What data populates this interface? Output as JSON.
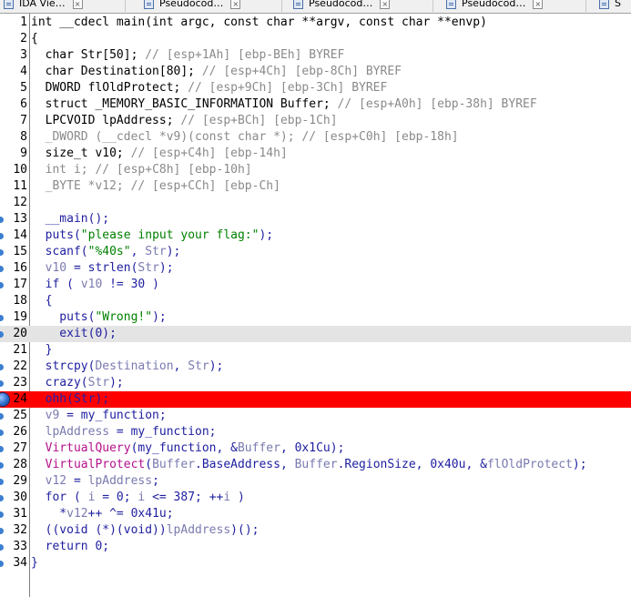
{
  "tabs": [
    {
      "label": "IDA Vie…"
    },
    {
      "label": "Pseudocod…"
    },
    {
      "label": "Pseudocod…"
    },
    {
      "label": "Pseudocod…"
    },
    {
      "label": "S"
    }
  ],
  "tab_close_glyph": "×",
  "colors": {
    "breakpoint_line": "#ff0000",
    "current_line": "#e4e4e4",
    "line_marker": "#3c7fd1"
  },
  "lines": [
    {
      "n": "1",
      "marker": "none",
      "hl": "",
      "t": [
        [
          "int __cdecl main(int argc, const char **argv, const char **envp)",
          "black"
        ]
      ]
    },
    {
      "n": "2",
      "marker": "none",
      "hl": "",
      "t": [
        [
          "{",
          "black"
        ]
      ]
    },
    {
      "n": "3",
      "marker": "none",
      "hl": "",
      "t": [
        [
          "  char Str[50]; ",
          "black"
        ],
        [
          "// [esp+1Ah] [ebp-BEh] BYREF",
          "gray"
        ]
      ]
    },
    {
      "n": "4",
      "marker": "none",
      "hl": "",
      "t": [
        [
          "  char Destination[80]; ",
          "black"
        ],
        [
          "// [esp+4Ch] [ebp-8Ch] BYREF",
          "gray"
        ]
      ]
    },
    {
      "n": "5",
      "marker": "none",
      "hl": "",
      "t": [
        [
          "  DWORD flOldProtect; ",
          "black"
        ],
        [
          "// [esp+9Ch] [ebp-3Ch] BYREF",
          "gray"
        ]
      ]
    },
    {
      "n": "6",
      "marker": "none",
      "hl": "",
      "t": [
        [
          "  struct _MEMORY_BASIC_INFORMATION Buffer; ",
          "black"
        ],
        [
          "// [esp+A0h] [ebp-38h] BYREF",
          "gray"
        ]
      ]
    },
    {
      "n": "7",
      "marker": "none",
      "hl": "",
      "t": [
        [
          "  LPCVOID lpAddress; ",
          "black"
        ],
        [
          "// [esp+BCh] [ebp-1Ch]",
          "gray"
        ]
      ]
    },
    {
      "n": "8",
      "marker": "none",
      "hl": "",
      "t": [
        [
          "  _DWORD (__cdecl *v9)(const char *); ",
          "gray"
        ],
        [
          "// [esp+C0h] [ebp-18h]",
          "gray"
        ]
      ]
    },
    {
      "n": "9",
      "marker": "none",
      "hl": "",
      "t": [
        [
          "  size_t v10; ",
          "black"
        ],
        [
          "// [esp+C4h] [ebp-14h]",
          "gray"
        ]
      ]
    },
    {
      "n": "10",
      "marker": "none",
      "hl": "",
      "t": [
        [
          "  int i; ",
          "gray"
        ],
        [
          "// [esp+C8h] [ebp-10h]",
          "gray"
        ]
      ]
    },
    {
      "n": "11",
      "marker": "none",
      "hl": "",
      "t": [
        [
          "  _BYTE *v12; ",
          "gray"
        ],
        [
          "// [esp+CCh] [ebp-Ch]",
          "gray"
        ]
      ]
    },
    {
      "n": "12",
      "marker": "none",
      "hl": "",
      "t": [
        [
          "",
          "black"
        ]
      ]
    },
    {
      "n": "13",
      "marker": "dot",
      "hl": "",
      "t": [
        [
          "  __main();",
          "blue"
        ]
      ]
    },
    {
      "n": "14",
      "marker": "dot",
      "hl": "",
      "t": [
        [
          "  puts(",
          "blue"
        ],
        [
          "\"please input your flag:\"",
          "green"
        ],
        [
          ");",
          "blue"
        ]
      ]
    },
    {
      "n": "15",
      "marker": "dot",
      "hl": "",
      "t": [
        [
          "  scanf(",
          "blue"
        ],
        [
          "\"%40s\"",
          "green"
        ],
        [
          ", ",
          "blue"
        ],
        [
          "Str",
          "mute"
        ],
        [
          ");",
          "blue"
        ]
      ]
    },
    {
      "n": "16",
      "marker": "dot",
      "hl": "",
      "t": [
        [
          "  v10",
          "mute"
        ],
        [
          " = strlen(",
          "blue"
        ],
        [
          "Str",
          "mute"
        ],
        [
          ");",
          "blue"
        ]
      ]
    },
    {
      "n": "17",
      "marker": "dot",
      "hl": "",
      "t": [
        [
          "  if ( ",
          "blue"
        ],
        [
          "v10",
          "mute"
        ],
        [
          " != 30 )",
          "blue"
        ]
      ]
    },
    {
      "n": "18",
      "marker": "none",
      "hl": "",
      "t": [
        [
          "  {",
          "blue"
        ]
      ]
    },
    {
      "n": "19",
      "marker": "dot",
      "hl": "",
      "t": [
        [
          "    puts(",
          "blue"
        ],
        [
          "\"Wrong!\"",
          "green"
        ],
        [
          ");",
          "blue"
        ]
      ]
    },
    {
      "n": "20",
      "marker": "dot",
      "hl": "gray",
      "t": [
        [
          "    exit(0);",
          "blue"
        ]
      ]
    },
    {
      "n": "21",
      "marker": "none",
      "hl": "",
      "t": [
        [
          "  }",
          "blue"
        ]
      ]
    },
    {
      "n": "22",
      "marker": "dot",
      "hl": "",
      "t": [
        [
          "  strcpy(",
          "blue"
        ],
        [
          "Destination",
          "mute"
        ],
        [
          ", ",
          "blue"
        ],
        [
          "Str",
          "mute"
        ],
        [
          ");",
          "blue"
        ]
      ]
    },
    {
      "n": "23",
      "marker": "dot",
      "hl": "",
      "t": [
        [
          "  crazy(",
          "blue"
        ],
        [
          "Str",
          "mute"
        ],
        [
          ");",
          "blue"
        ]
      ]
    },
    {
      "n": "24",
      "marker": "bp",
      "hl": "red",
      "t": [
        [
          "  ",
          "blue"
        ],
        [
          "ohh",
          "purple"
        ],
        [
          "(",
          "blue"
        ],
        [
          "Str",
          "mute"
        ],
        [
          ");",
          "blue"
        ]
      ]
    },
    {
      "n": "25",
      "marker": "dot",
      "hl": "",
      "t": [
        [
          "  v9",
          "mute"
        ],
        [
          " = my_function;",
          "blue"
        ]
      ]
    },
    {
      "n": "26",
      "marker": "dot",
      "hl": "",
      "t": [
        [
          "  lpAddress",
          "mute"
        ],
        [
          " = my_function;",
          "blue"
        ]
      ]
    },
    {
      "n": "27",
      "marker": "dot",
      "hl": "",
      "t": [
        [
          "  ",
          "blue"
        ],
        [
          "VirtualQuery",
          "mag"
        ],
        [
          "(my_function, &",
          "blue"
        ],
        [
          "Buffer",
          "mute"
        ],
        [
          ", 0x1Cu);",
          "blue"
        ]
      ]
    },
    {
      "n": "28",
      "marker": "dot",
      "hl": "",
      "t": [
        [
          "  ",
          "blue"
        ],
        [
          "VirtualProtect",
          "mag"
        ],
        [
          "(",
          "blue"
        ],
        [
          "Buffer",
          "mute"
        ],
        [
          ".BaseAddress, ",
          "blue"
        ],
        [
          "Buffer",
          "mute"
        ],
        [
          ".RegionSize, 0x40u, &",
          "blue"
        ],
        [
          "flOldProtect",
          "mute"
        ],
        [
          ");",
          "blue"
        ]
      ]
    },
    {
      "n": "29",
      "marker": "dot",
      "hl": "",
      "t": [
        [
          "  v12",
          "mute"
        ],
        [
          " = ",
          "blue"
        ],
        [
          "lpAddress",
          "mute"
        ],
        [
          ";",
          "blue"
        ]
      ]
    },
    {
      "n": "30",
      "marker": "dot",
      "hl": "",
      "t": [
        [
          "  for ( ",
          "blue"
        ],
        [
          "i",
          "mute"
        ],
        [
          " = 0; ",
          "blue"
        ],
        [
          "i",
          "mute"
        ],
        [
          " <= 387; ++",
          "blue"
        ],
        [
          "i",
          "mute"
        ],
        [
          " )",
          "blue"
        ]
      ]
    },
    {
      "n": "31",
      "marker": "dot",
      "hl": "",
      "t": [
        [
          "    *",
          "blue"
        ],
        [
          "v12",
          "mute"
        ],
        [
          "++ ^= 0x41u;",
          "blue"
        ]
      ]
    },
    {
      "n": "32",
      "marker": "dot",
      "hl": "",
      "t": [
        [
          "  ((void (*)(void))",
          "blue"
        ],
        [
          "lpAddress",
          "mute"
        ],
        [
          ")();",
          "blue"
        ]
      ]
    },
    {
      "n": "33",
      "marker": "dot",
      "hl": "",
      "t": [
        [
          "  return 0;",
          "blue"
        ]
      ]
    },
    {
      "n": "34",
      "marker": "dot",
      "hl": "",
      "t": [
        [
          "}",
          "blue"
        ]
      ]
    }
  ]
}
